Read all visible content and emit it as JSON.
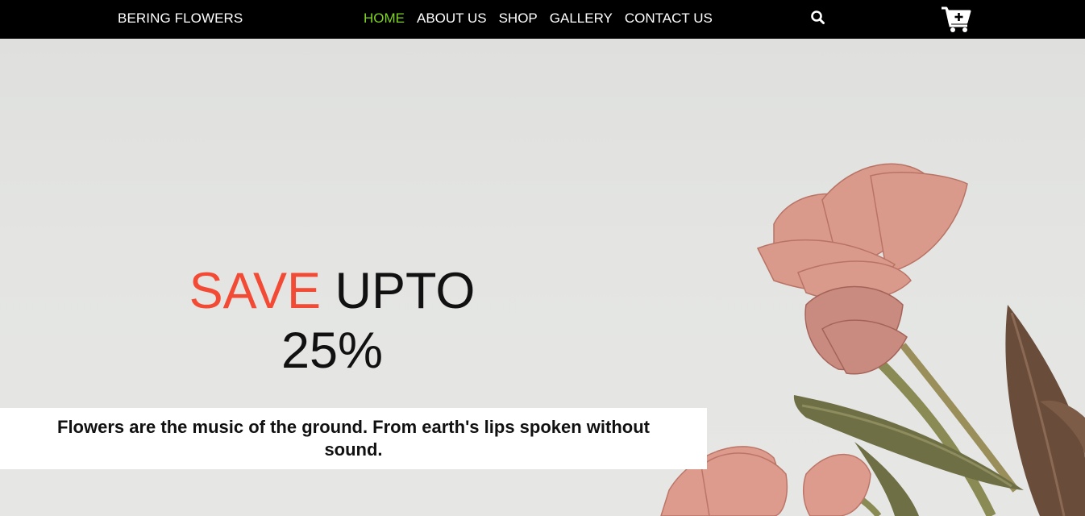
{
  "brand": {
    "name": "BERING FLOWERS"
  },
  "nav": {
    "items": [
      {
        "label": "HOME",
        "active": true
      },
      {
        "label": "ABOUT US",
        "active": false
      },
      {
        "label": "SHOP",
        "active": false
      },
      {
        "label": "GALLERY",
        "active": false
      },
      {
        "label": "CONTACT US",
        "active": false
      }
    ],
    "active_color": "#7ed321"
  },
  "icons": {
    "search": "search-icon",
    "cart": "cart-plus-icon"
  },
  "hero": {
    "promo_word": "SAVE",
    "promo_rest": "UPTO",
    "promo_amount": "25%",
    "promo_accent_color": "#f24a34",
    "quote": "Flowers are the music of the ground. From earth's lips spoken without sound."
  }
}
